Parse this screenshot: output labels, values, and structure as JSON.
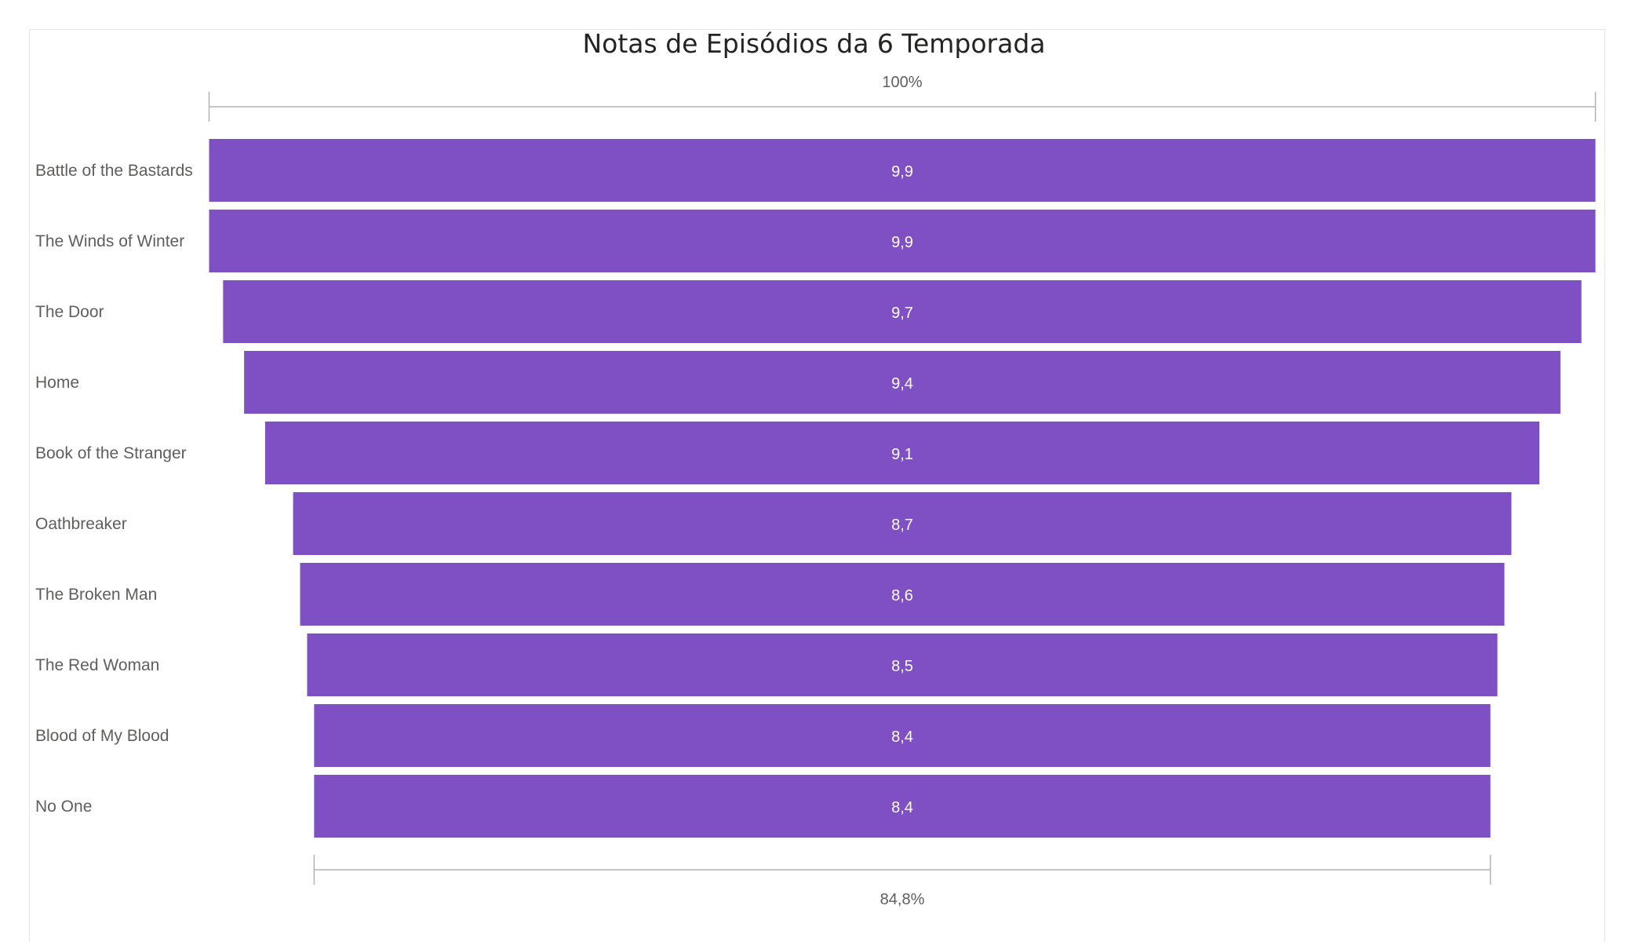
{
  "chart_data": {
    "type": "funnel",
    "title": "Notas de Episódios da 6 Temporada",
    "categories": [
      "Battle of the Bastards",
      "The Winds of Winter",
      "The Door",
      "Home",
      "Book of the Stranger",
      "Oathbreaker",
      "The Broken Man",
      "The Red Woman",
      "Blood of My Blood",
      "No One"
    ],
    "values": [
      9.9,
      9.9,
      9.7,
      9.4,
      9.1,
      8.7,
      8.6,
      8.5,
      8.4,
      8.4
    ],
    "value_labels": [
      "9,9",
      "9,9",
      "9,7",
      "9,4",
      "9,1",
      "8,7",
      "8,6",
      "8,5",
      "8,4",
      "8,4"
    ],
    "top_percent_label": "100%",
    "bottom_percent_label": "84,8%",
    "bar_color": "#7f4fc4"
  }
}
